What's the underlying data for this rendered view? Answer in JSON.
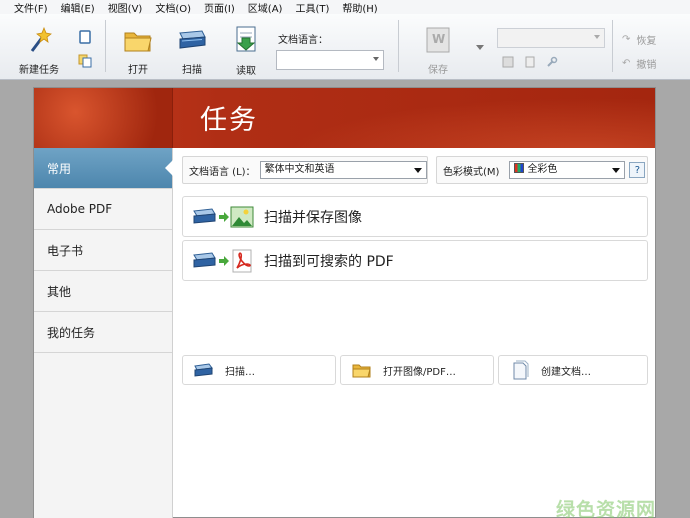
{
  "menu": [
    "文件(F)",
    "编辑(E)",
    "视图(V)",
    "文档(O)",
    "页面(I)",
    "区域(A)",
    "工具(T)",
    "帮助(H)"
  ],
  "toolbar": {
    "new_task": "新建任务",
    "open": "打开",
    "scan": "扫描",
    "read": "读取",
    "doc_lang_label": "文档语言：",
    "save": "保存",
    "restore": "恢复",
    "undo": "撤销"
  },
  "header": {
    "title": "任务"
  },
  "sidebar": {
    "items": [
      {
        "label": "常用"
      },
      {
        "label": "Adobe PDF"
      },
      {
        "label": "电子书"
      },
      {
        "label": "其他"
      },
      {
        "label": "我的任务"
      }
    ]
  },
  "options": {
    "doc_lang_label": "文档语言 (L)：",
    "doc_lang_value": "繁体中文和英语",
    "color_mode_label": "色彩模式(M)",
    "color_mode_value": "全彩色",
    "help": "?"
  },
  "tasks": {
    "scan_save_image": "扫描并保存图像",
    "scan_to_pdf": "扫描到可搜索的 PDF"
  },
  "quick": {
    "scan": "扫描…",
    "open_image_pdf": "打开图像/PDF…",
    "create_doc": "创建文档…"
  },
  "watermark": "绿色资源网",
  "colors": {
    "header": "#b02e15",
    "sidebar_active": "#5b92b8",
    "background": "#a8a8a8"
  }
}
